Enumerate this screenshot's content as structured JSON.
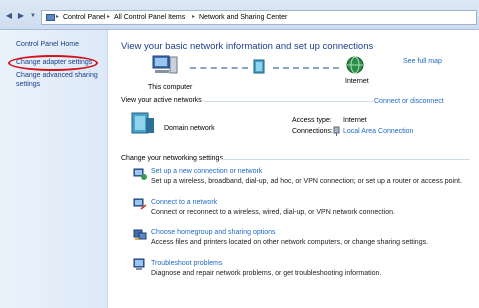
{
  "address_bar": {
    "breadcrumbs": [
      "Control Panel",
      "All Control Panel Items",
      "Network and Sharing Center"
    ],
    "back_icon": "back-arrow-icon",
    "forward_icon": "forward-arrow-icon"
  },
  "sidebar": {
    "items": [
      {
        "label": "Control Panel Home"
      },
      {
        "label": "Change adapter settings"
      },
      {
        "label": "Change advanced sharing"
      },
      {
        "label": "settings"
      }
    ],
    "highlight_color": "#d3131a"
  },
  "main": {
    "title": "View your basic network information and set up connections",
    "see_full_map": "See full map",
    "map": {
      "computer_label": "This computer",
      "internet_label": "Internet"
    },
    "active_networks": {
      "header": "View your active networks",
      "connect_link": "Connect or disconnect",
      "network_name": "Domain network",
      "access_type_label": "Access type:",
      "access_type_value": "Internet",
      "connections_label": "Connections:",
      "connections_value": "Local Area Connection"
    },
    "settings": {
      "header": "Change your networking settings",
      "tasks": [
        {
          "title": "Set up a new connection or network",
          "desc": "Set up a wireless, broadband, dial-up, ad hoc, or VPN connection; or set up a router or access point."
        },
        {
          "title": "Connect to a network",
          "desc": "Connect or reconnect to a wireless, wired, dial-up, or VPN network connection."
        },
        {
          "title": "Choose homegroup and sharing options",
          "desc": "Access files and printers located on other network computers, or change sharing settings."
        },
        {
          "title": "Troubleshoot problems",
          "desc": "Diagnose and repair network problems, or get troubleshooting information."
        }
      ]
    }
  }
}
